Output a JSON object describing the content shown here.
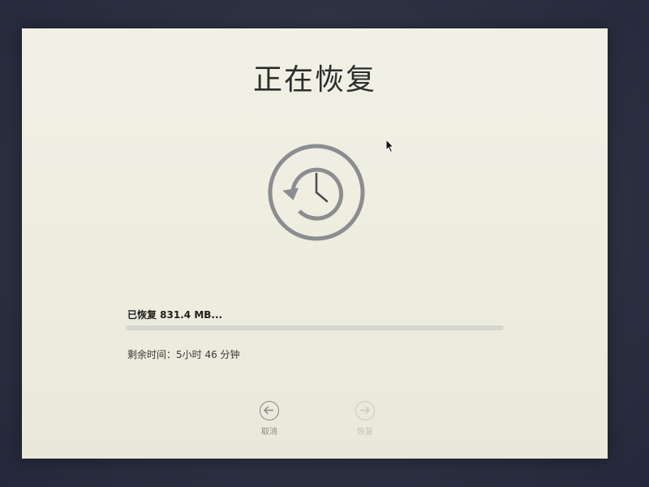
{
  "window": {
    "title": "正在恢复"
  },
  "progress": {
    "label": "已恢复 831.4 MB...",
    "fraction": 0.0,
    "time_remaining": "剩余时间：5小时 46 分钟"
  },
  "icons": {
    "main": "time-machine-restore-icon",
    "back": "arrow-left-circle-icon",
    "continue": "arrow-right-circle-icon",
    "cursor": "mouse-pointer-icon"
  },
  "buttons": {
    "back_label": "取消",
    "continue_label": "恢复",
    "continue_enabled": false
  },
  "colors": {
    "screen_background": "#eeeddf",
    "title_text": "#2d2d2d",
    "icon_stroke": "#8c8d90",
    "progress_track": "#d5d6d0"
  }
}
